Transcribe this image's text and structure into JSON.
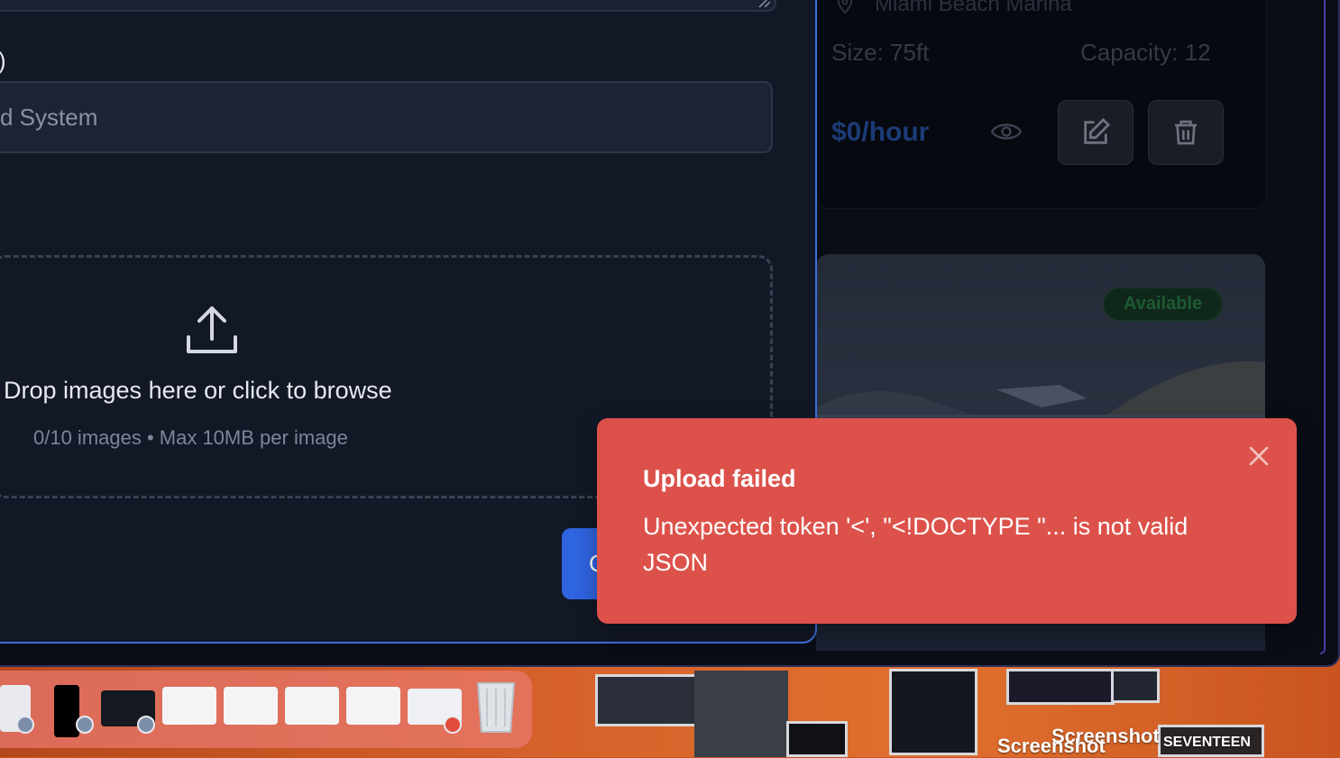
{
  "listing": {
    "location": "Miami Beach Marina",
    "size": "Size: 75ft",
    "capacity": "Capacity: 12",
    "price": "$0/hour",
    "badge": "Available"
  },
  "modal": {
    "field_label": ")",
    "input_value": "d System",
    "dropzone_title": "Drop images here or click to browse",
    "dropzone_sub": "0/10 images • Max 10MB per image",
    "primary_button": "C"
  },
  "toast": {
    "title": "Upload failed",
    "message": "Unexpected token '<', \"<!DOCTYPE \"... is not valid JSON",
    "color": "#dc524b"
  },
  "desktop": {
    "labels": [
      "Screenshot",
      "Screenshot",
      "SEVENTEEN"
    ]
  },
  "colors": {
    "accent": "#2f64e0",
    "modal_border": "#3d6fdc"
  }
}
